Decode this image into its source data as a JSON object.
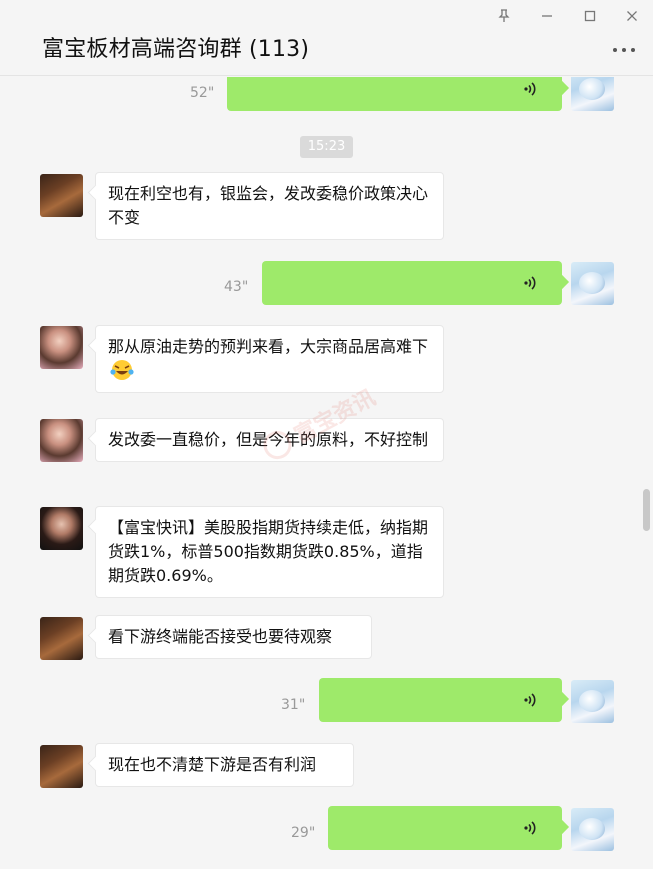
{
  "window": {
    "title": "富宝板材高端咨询群 (113)"
  },
  "messages": {
    "voice1_duration": "52\"",
    "time1": "15:23",
    "text1": "现在利空也有，银监会，发改委稳价政策决心不变",
    "voice2_duration": "43\"",
    "text2": "那从原油走势的预判来看，大宗商品居高难下",
    "text3": "发改委一直稳价，但是今年的原料，不好控制",
    "text4": "【富宝快讯】美股股指期货持续走低，纳指期货跌1%，标普500指数期货跌0.85%，道指期货跌0.69%。",
    "text5": "看下游终端能否接受也要待观察",
    "voice3_duration": "31\"",
    "text6": "现在也不清楚下游是否有利润",
    "voice4_duration": "29\""
  },
  "watermark": {
    "text": "富宝资讯"
  },
  "colors": {
    "my_bubble": "#9eea6a",
    "other_bubble": "#ffffff",
    "background": "#f5f5f5"
  },
  "icons": {
    "pin": "pin-icon",
    "minimize": "minimize-icon",
    "maximize": "maximize-icon",
    "close": "close-icon",
    "more": "more-icon",
    "voice": "voice-wave-icon",
    "emoji": "laughing-tears-emoji-icon"
  }
}
